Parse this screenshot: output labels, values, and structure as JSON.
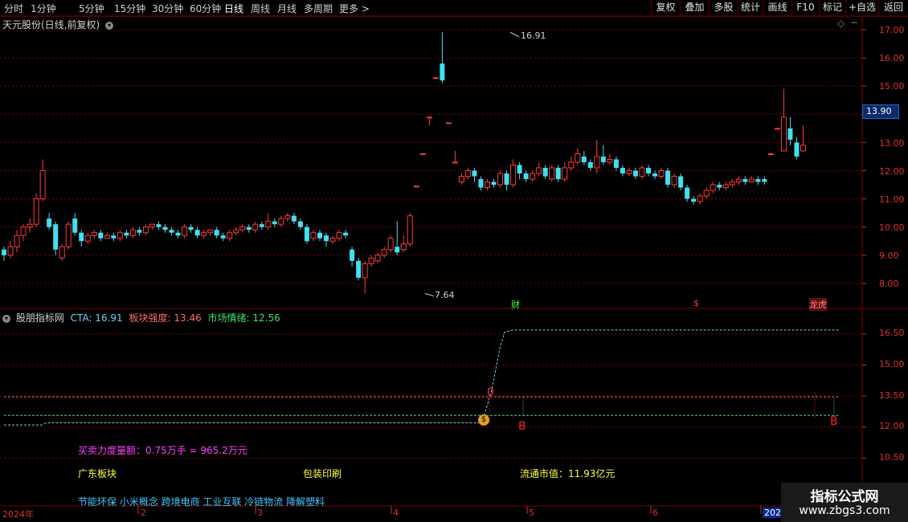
{
  "toolbar": {
    "timeframes": [
      "分时",
      "1分钟",
      "5分钟",
      "15分钟",
      "30分钟",
      "60分钟",
      "日线",
      "周线",
      "月线",
      "多周期",
      "更多 >"
    ],
    "active_timeframe": "日线",
    "right_buttons": [
      "复权",
      "叠加",
      "多股",
      "统计",
      "画线",
      "F10",
      "标记",
      "+自选",
      "返回"
    ]
  },
  "main_chart": {
    "title": "天元股份(日线,前复权)",
    "dropdown_icon": "chevron-down-icon",
    "y_ticks": [
      "17.00",
      "16.00",
      "15.00",
      "14.00",
      "13.00",
      "12.00",
      "11.00",
      "10.00",
      "9.00",
      "8.00"
    ],
    "current_price_tag": "13.90",
    "high_label": "16.91",
    "low_label": "7.64",
    "event_markers": [
      "财",
      "$",
      "龙虎"
    ]
  },
  "indicator_panel": {
    "name": "股朋指标网",
    "cta_label": "CTA: 16.91",
    "sector_strength_label": "板块强度: 13.46",
    "market_sentiment_label": "市场情绪: 12.56",
    "y_ticks": [
      "16.50",
      "15.00",
      "13.50",
      "12.00",
      "10.50"
    ],
    "signal_zero": "0",
    "signal_b1": "B",
    "signal_b2": "B",
    "buy_sell_power": "买卖力度量额：0.75万手 = 965.2万元",
    "region_sector": "广东板块",
    "industry": "包装印刷",
    "float_market_value": "流通市值：11.93亿元",
    "concepts": "节能环保 小米概念 跨境电商 工业互联 冷链物流 降解塑料"
  },
  "time_axis": {
    "labels": [
      "2024年",
      "2",
      "3",
      "4",
      "5",
      "6",
      "202"
    ]
  },
  "watermark": {
    "line1": "指标公式网",
    "line2": "www.zbgs3.com"
  },
  "colors": {
    "up": "#ff3b3b",
    "down": "#40e0f0",
    "grid": "#7a0000",
    "cta_line": "#60d8f0",
    "sector_line": "#ff5a5a",
    "sentiment_line": "#40e070"
  },
  "chart_data": {
    "type": "candlestick",
    "price_axis": [
      8,
      17
    ],
    "series": [
      {
        "name": "K线",
        "values": [
          {
            "o": 9.2,
            "c": 9.0,
            "h": 9.3,
            "l": 8.8
          },
          {
            "o": 9.0,
            "c": 9.3,
            "h": 9.5,
            "l": 8.9
          },
          {
            "o": 9.3,
            "c": 9.7,
            "h": 9.9,
            "l": 9.1
          },
          {
            "o": 9.7,
            "c": 10.0,
            "h": 10.1,
            "l": 9.5
          },
          {
            "o": 10.0,
            "c": 10.1,
            "h": 10.3,
            "l": 9.8
          },
          {
            "o": 10.1,
            "c": 11.0,
            "h": 11.2,
            "l": 10.0
          },
          {
            "o": 11.0,
            "c": 12.0,
            "h": 12.4,
            "l": 10.9
          },
          {
            "o": 10.3,
            "c": 10.0,
            "h": 10.5,
            "l": 9.9
          },
          {
            "o": 10.1,
            "c": 9.2,
            "h": 10.2,
            "l": 9.0
          },
          {
            "o": 8.9,
            "c": 9.3,
            "h": 9.4,
            "l": 8.8
          },
          {
            "o": 9.3,
            "c": 10.1,
            "h": 10.2,
            "l": 9.2
          },
          {
            "o": 10.3,
            "c": 9.8,
            "h": 10.5,
            "l": 9.7
          },
          {
            "o": 9.8,
            "c": 9.5,
            "h": 9.9,
            "l": 9.3
          },
          {
            "o": 9.5,
            "c": 9.7,
            "h": 9.8,
            "l": 9.4
          },
          {
            "o": 9.7,
            "c": 9.8,
            "h": 9.9,
            "l": 9.6
          },
          {
            "o": 9.8,
            "c": 9.6,
            "h": 9.9,
            "l": 9.5
          },
          {
            "o": 9.6,
            "c": 9.7,
            "h": 9.8,
            "l": 9.6
          },
          {
            "o": 9.7,
            "c": 9.6,
            "h": 9.8,
            "l": 9.5
          },
          {
            "o": 9.6,
            "c": 9.8,
            "h": 9.9,
            "l": 9.5
          },
          {
            "o": 9.8,
            "c": 9.7,
            "h": 9.9,
            "l": 9.6
          },
          {
            "o": 9.7,
            "c": 9.9,
            "h": 10.0,
            "l": 9.6
          },
          {
            "o": 9.9,
            "c": 9.8,
            "h": 10.0,
            "l": 9.7
          },
          {
            "o": 9.8,
            "c": 10.0,
            "h": 10.1,
            "l": 9.7
          },
          {
            "o": 10.0,
            "c": 10.1,
            "h": 10.1,
            "l": 9.9
          },
          {
            "o": 10.1,
            "c": 10.0,
            "h": 10.2,
            "l": 9.9
          },
          {
            "o": 10.0,
            "c": 9.9,
            "h": 10.1,
            "l": 9.8
          },
          {
            "o": 9.9,
            "c": 9.8,
            "h": 10.0,
            "l": 9.7
          },
          {
            "o": 9.8,
            "c": 9.7,
            "h": 9.9,
            "l": 9.6
          },
          {
            "o": 9.7,
            "c": 10.0,
            "h": 10.1,
            "l": 9.6
          },
          {
            "o": 10.0,
            "c": 9.9,
            "h": 10.1,
            "l": 9.8
          },
          {
            "o": 9.9,
            "c": 9.7,
            "h": 10.0,
            "l": 9.6
          },
          {
            "o": 9.7,
            "c": 9.8,
            "h": 9.9,
            "l": 9.6
          },
          {
            "o": 9.8,
            "c": 9.9,
            "h": 9.9,
            "l": 9.7
          },
          {
            "o": 9.9,
            "c": 9.7,
            "h": 10.0,
            "l": 9.6
          },
          {
            "o": 9.7,
            "c": 9.6,
            "h": 9.8,
            "l": 9.5
          },
          {
            "o": 9.6,
            "c": 9.8,
            "h": 9.9,
            "l": 9.5
          },
          {
            "o": 9.8,
            "c": 9.9,
            "h": 10.0,
            "l": 9.7
          },
          {
            "o": 9.9,
            "c": 10.0,
            "h": 10.1,
            "l": 9.8
          },
          {
            "o": 10.0,
            "c": 9.9,
            "h": 10.1,
            "l": 9.8
          },
          {
            "o": 9.9,
            "c": 10.1,
            "h": 10.2,
            "l": 9.8
          },
          {
            "o": 10.1,
            "c": 10.0,
            "h": 10.2,
            "l": 9.9
          },
          {
            "o": 10.0,
            "c": 10.2,
            "h": 10.5,
            "l": 9.9
          },
          {
            "o": 10.2,
            "c": 10.1,
            "h": 10.3,
            "l": 10.0
          },
          {
            "o": 10.1,
            "c": 10.3,
            "h": 10.4,
            "l": 10.0
          },
          {
            "o": 10.3,
            "c": 10.4,
            "h": 10.5,
            "l": 10.2
          },
          {
            "o": 10.4,
            "c": 10.2,
            "h": 10.5,
            "l": 10.1
          },
          {
            "o": 10.2,
            "c": 10.0,
            "h": 10.3,
            "l": 9.9
          },
          {
            "o": 10.0,
            "c": 9.5,
            "h": 10.1,
            "l": 9.4
          },
          {
            "o": 9.6,
            "c": 9.8,
            "h": 9.9,
            "l": 9.5
          },
          {
            "o": 9.8,
            "c": 9.6,
            "h": 9.9,
            "l": 9.5
          },
          {
            "o": 9.7,
            "c": 9.5,
            "h": 9.8,
            "l": 9.3
          },
          {
            "o": 9.5,
            "c": 9.6,
            "h": 9.7,
            "l": 9.4
          },
          {
            "o": 9.6,
            "c": 9.8,
            "h": 9.9,
            "l": 9.5
          },
          {
            "o": 9.8,
            "c": 9.7,
            "h": 9.9,
            "l": 9.6
          },
          {
            "o": 9.2,
            "c": 8.8,
            "h": 9.3,
            "l": 8.6
          },
          {
            "o": 8.8,
            "c": 8.2,
            "h": 8.9,
            "l": 8.1
          },
          {
            "o": 8.2,
            "c": 8.7,
            "h": 8.8,
            "l": 7.64
          },
          {
            "o": 8.7,
            "c": 8.9,
            "h": 9.0,
            "l": 8.6
          },
          {
            "o": 8.8,
            "c": 9.0,
            "h": 9.1,
            "l": 8.7
          },
          {
            "o": 9.0,
            "c": 9.2,
            "h": 9.3,
            "l": 8.9
          },
          {
            "o": 9.2,
            "c": 9.6,
            "h": 9.7,
            "l": 9.1
          },
          {
            "o": 9.3,
            "c": 9.1,
            "h": 10.2,
            "l": 9.0
          },
          {
            "o": 9.2,
            "c": 9.4,
            "h": 9.7,
            "l": 9.1
          },
          {
            "o": 9.4,
            "c": 10.4,
            "h": 10.5,
            "l": 9.3
          },
          {
            "o": 11.45,
            "c": 11.45,
            "h": 11.45,
            "l": 11.45
          },
          {
            "o": 12.6,
            "c": 12.6,
            "h": 12.6,
            "l": 12.6
          },
          {
            "o": 13.9,
            "c": 13.9,
            "h": 13.9,
            "l": 13.6
          },
          {
            "o": 15.3,
            "c": 15.3,
            "h": 15.3,
            "l": 15.3
          },
          {
            "o": 15.8,
            "c": 15.2,
            "h": 16.91,
            "l": 15.1
          },
          {
            "o": 13.7,
            "c": 13.7,
            "h": 13.7,
            "l": 13.7
          },
          {
            "o": 12.3,
            "c": 12.3,
            "h": 12.7,
            "l": 12.3
          },
          {
            "o": 11.6,
            "c": 11.8,
            "h": 11.9,
            "l": 11.5
          },
          {
            "o": 11.8,
            "c": 12.0,
            "h": 12.1,
            "l": 11.7
          },
          {
            "o": 12.0,
            "c": 11.8,
            "h": 12.1,
            "l": 11.6
          },
          {
            "o": 11.7,
            "c": 11.4,
            "h": 11.8,
            "l": 11.3
          },
          {
            "o": 11.4,
            "c": 11.6,
            "h": 11.7,
            "l": 11.3
          },
          {
            "o": 11.6,
            "c": 11.5,
            "h": 11.7,
            "l": 11.4
          },
          {
            "o": 11.5,
            "c": 11.9,
            "h": 12.0,
            "l": 11.4
          },
          {
            "o": 11.9,
            "c": 11.5,
            "h": 12.0,
            "l": 11.3
          },
          {
            "o": 11.5,
            "c": 12.2,
            "h": 12.4,
            "l": 11.4
          },
          {
            "o": 12.2,
            "c": 11.9,
            "h": 12.3,
            "l": 11.7
          },
          {
            "o": 11.9,
            "c": 11.7,
            "h": 12.0,
            "l": 11.6
          },
          {
            "o": 11.7,
            "c": 11.9,
            "h": 12.0,
            "l": 11.6
          },
          {
            "o": 11.9,
            "c": 12.1,
            "h": 12.3,
            "l": 11.8
          },
          {
            "o": 12.1,
            "c": 11.8,
            "h": 12.2,
            "l": 11.7
          },
          {
            "o": 11.7,
            "c": 12.1,
            "h": 12.2,
            "l": 11.6
          },
          {
            "o": 12.1,
            "c": 11.7,
            "h": 12.2,
            "l": 11.6
          },
          {
            "o": 11.7,
            "c": 12.1,
            "h": 12.3,
            "l": 11.6
          },
          {
            "o": 12.1,
            "c": 12.3,
            "h": 12.5,
            "l": 12.0
          },
          {
            "o": 12.3,
            "c": 12.6,
            "h": 12.8,
            "l": 12.2
          },
          {
            "o": 12.5,
            "c": 12.3,
            "h": 12.7,
            "l": 12.2
          },
          {
            "o": 12.3,
            "c": 12.1,
            "h": 12.4,
            "l": 12.0
          },
          {
            "o": 12.1,
            "c": 12.5,
            "h": 13.1,
            "l": 11.9
          },
          {
            "o": 12.5,
            "c": 12.3,
            "h": 12.9,
            "l": 12.2
          },
          {
            "o": 12.3,
            "c": 12.4,
            "h": 12.6,
            "l": 12.2
          },
          {
            "o": 12.4,
            "c": 12.1,
            "h": 12.5,
            "l": 12.0
          },
          {
            "o": 12.1,
            "c": 11.9,
            "h": 12.2,
            "l": 11.8
          },
          {
            "o": 11.9,
            "c": 12.0,
            "h": 12.1,
            "l": 11.8
          },
          {
            "o": 12.0,
            "c": 11.8,
            "h": 12.1,
            "l": 11.7
          },
          {
            "o": 11.8,
            "c": 12.1,
            "h": 12.2,
            "l": 11.7
          },
          {
            "o": 12.1,
            "c": 11.9,
            "h": 12.2,
            "l": 11.8
          },
          {
            "o": 11.9,
            "c": 11.8,
            "h": 12.0,
            "l": 11.7
          },
          {
            "o": 11.8,
            "c": 12.0,
            "h": 12.1,
            "l": 11.7
          },
          {
            "o": 12.0,
            "c": 11.5,
            "h": 12.1,
            "l": 11.4
          },
          {
            "o": 11.5,
            "c": 11.8,
            "h": 11.9,
            "l": 11.4
          },
          {
            "o": 11.8,
            "c": 11.4,
            "h": 11.9,
            "l": 11.3
          },
          {
            "o": 11.4,
            "c": 11.0,
            "h": 11.5,
            "l": 10.9
          },
          {
            "o": 11.0,
            "c": 10.9,
            "h": 11.1,
            "l": 10.8
          },
          {
            "o": 10.9,
            "c": 11.1,
            "h": 11.2,
            "l": 10.8
          },
          {
            "o": 11.1,
            "c": 11.3,
            "h": 11.4,
            "l": 11.0
          },
          {
            "o": 11.3,
            "c": 11.5,
            "h": 11.6,
            "l": 11.2
          },
          {
            "o": 11.5,
            "c": 11.4,
            "h": 11.6,
            "l": 11.3
          },
          {
            "o": 11.4,
            "c": 11.5,
            "h": 11.6,
            "l": 11.3
          },
          {
            "o": 11.5,
            "c": 11.6,
            "h": 11.7,
            "l": 11.4
          },
          {
            "o": 11.6,
            "c": 11.7,
            "h": 11.8,
            "l": 11.5
          },
          {
            "o": 11.7,
            "c": 11.6,
            "h": 11.8,
            "l": 11.5
          },
          {
            "o": 11.6,
            "c": 11.7,
            "h": 11.8,
            "l": 11.6
          },
          {
            "o": 11.7,
            "c": 11.6,
            "h": 11.8,
            "l": 11.5
          },
          {
            "o": 11.7,
            "c": 11.6,
            "h": 11.8,
            "l": 11.5
          },
          {
            "o": 12.6,
            "c": 12.6,
            "h": 12.6,
            "l": 12.6
          },
          {
            "o": 13.5,
            "c": 13.5,
            "h": 13.5,
            "l": 13.5
          },
          {
            "o": 12.7,
            "c": 13.9,
            "h": 14.9,
            "l": 12.7
          },
          {
            "o": 13.5,
            "c": 13.1,
            "h": 13.9,
            "l": 12.9
          },
          {
            "o": 13.0,
            "c": 12.5,
            "h": 13.2,
            "l": 12.4
          },
          {
            "o": 12.7,
            "c": 12.9,
            "h": 13.6,
            "l": 12.7
          }
        ]
      }
    ]
  }
}
